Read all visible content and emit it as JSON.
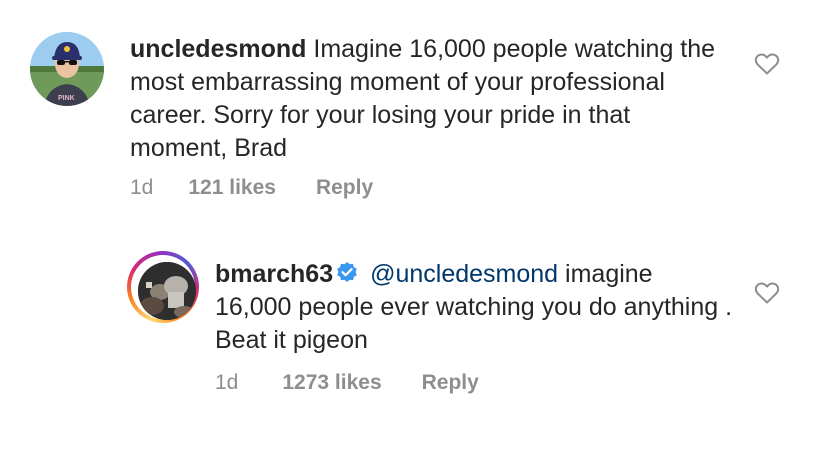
{
  "comments": [
    {
      "username": "uncledesmond",
      "text": "Imagine 16,000 people watching the most embarrassing moment of your professional career. Sorry for your losing your pride in that moment, Brad",
      "time": "1d",
      "likes": "121 likes",
      "reply": "Reply",
      "avatar_icon": "user-avatar-photo",
      "like_icon": "heart-outline-icon"
    },
    {
      "username": "bmarch63",
      "verified": true,
      "mention": "@uncledesmond",
      "text": "imagine 16,000 people ever watching you do anything . Beat it pigeon",
      "time": "1d",
      "likes": "1273 likes",
      "reply": "Reply",
      "avatar_icon": "user-avatar-photo",
      "like_icon": "heart-outline-icon"
    }
  ],
  "colors": {
    "mention": "#00376b",
    "muted": "#8e8e8e",
    "verified": "#3897f0"
  }
}
